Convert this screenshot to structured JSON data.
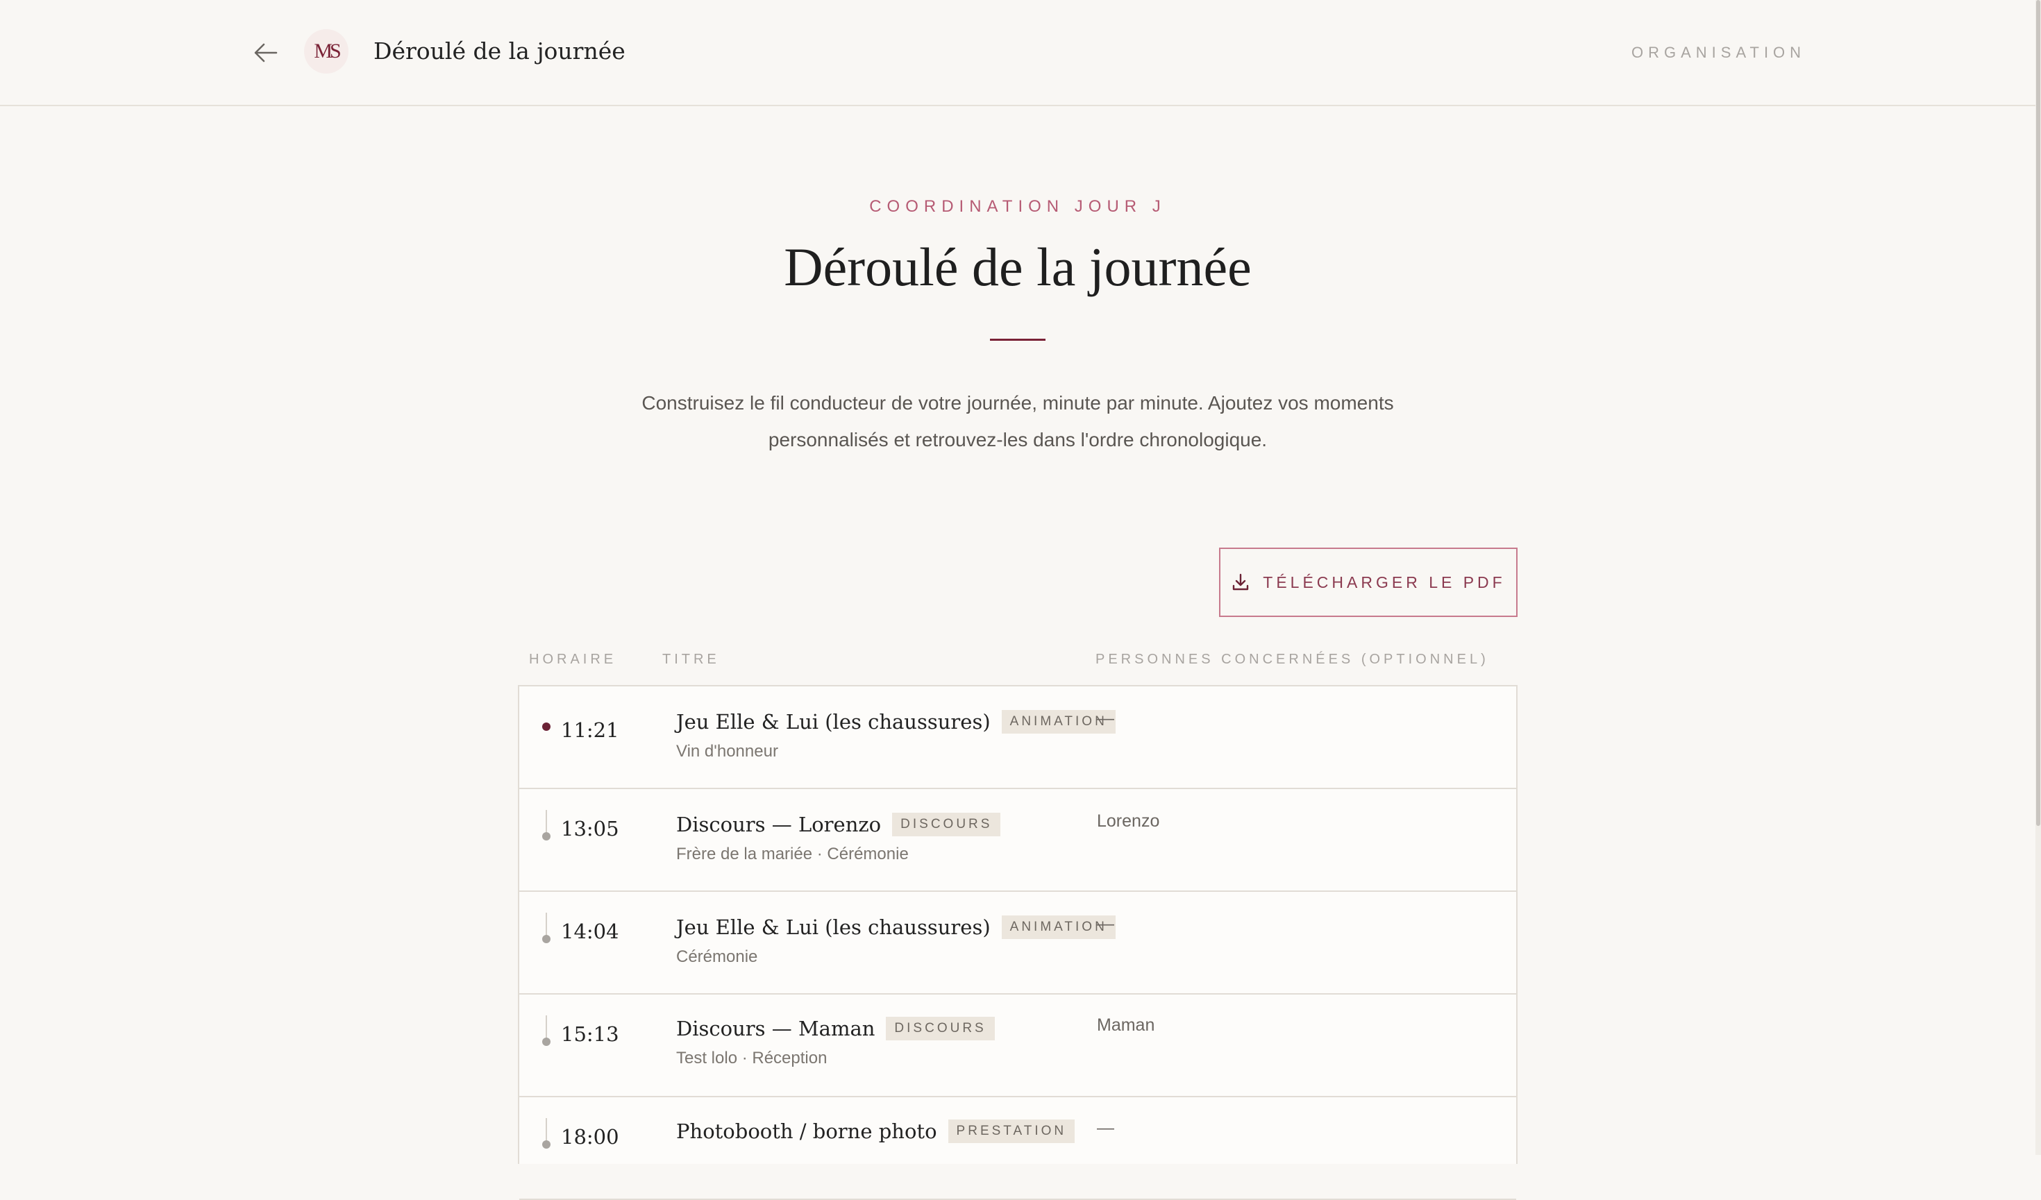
{
  "header": {
    "title": "Déroulé de la journée",
    "logo_text": "MS",
    "org_link": "ORGANISATION"
  },
  "intro": {
    "eyebrow": "COORDINATION JOUR J",
    "title": "Déroulé de la journée",
    "description": "Construisez le fil conducteur de votre journée, minute par minute. Ajoutez vos moments personnalisés et retrouvez-les dans l'ordre chronologique."
  },
  "pdf_button": {
    "label": "TÉLÉCHARGER LE PDF"
  },
  "table": {
    "headers": {
      "time": "HORAIRE",
      "title": "TITRE",
      "persons": "PERSONNES CONCERNÉES (OPTIONNEL)"
    },
    "rows": [
      {
        "time": "11:21",
        "title": "Jeu Elle & Lui (les chaussures)",
        "tag": "ANIMATION",
        "subtitle": "Vin d'honneur",
        "persons": "—"
      },
      {
        "time": "13:05",
        "title": "Discours — Lorenzo",
        "tag": "DISCOURS",
        "subtitle": "Frère de la mariée · Cérémonie",
        "persons": "Lorenzo"
      },
      {
        "time": "14:04",
        "title": "Jeu Elle & Lui (les chaussures)",
        "tag": "ANIMATION",
        "subtitle": "Cérémonie",
        "persons": "—"
      },
      {
        "time": "15:13",
        "title": "Discours — Maman",
        "tag": "DISCOURS",
        "subtitle": "Test lolo · Réception",
        "persons": "Maman"
      },
      {
        "time": "18:00",
        "title": "Photobooth / borne photo",
        "tag": "PRESTATION",
        "subtitle": "",
        "persons": "—"
      }
    ]
  },
  "icons": {
    "back": "arrow-left-icon",
    "download": "download-icon"
  },
  "colors": {
    "accent": "#7a2236",
    "accent_light": "#b65b74",
    "background": "#f9f7f4",
    "tag_bg": "#ece6dd",
    "border": "#e1dcd5"
  }
}
